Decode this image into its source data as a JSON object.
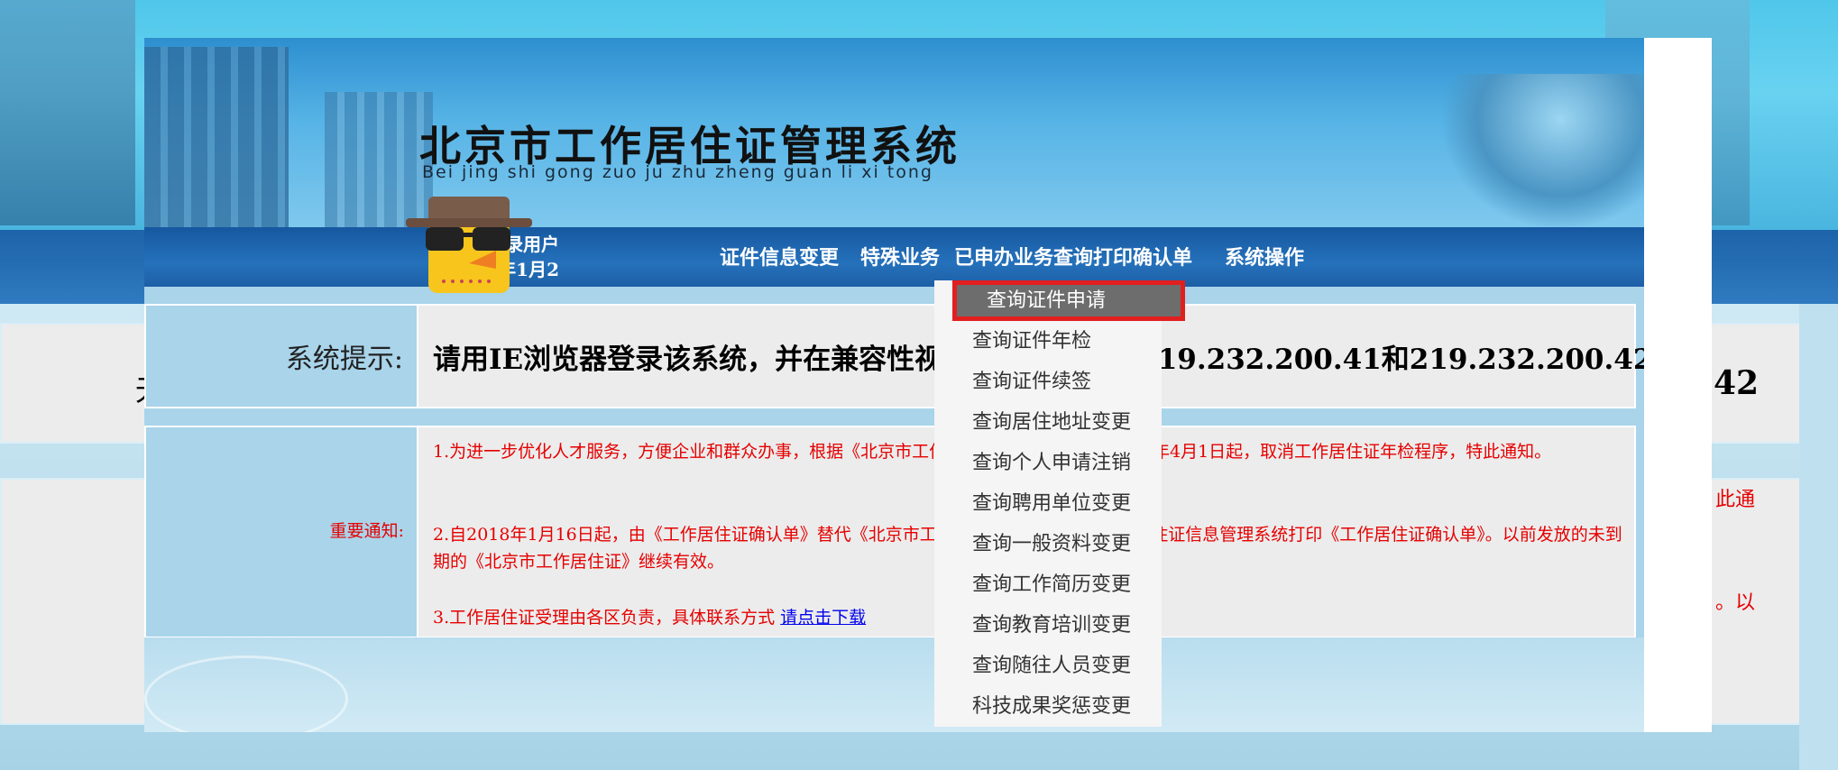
{
  "background": {
    "notice_end_fragment": "42",
    "red_fragment_1": "此通",
    "red_fragment_2": "。以",
    "left_fragment": "无"
  },
  "header": {
    "title": "北京市工作居住证管理系统",
    "pinyin": "Bei jing shi gong zuo ju zhu zheng guan li xi tong"
  },
  "login": {
    "line1": "登录用户",
    "line2": "121年1月2"
  },
  "nav": {
    "items": [
      "证件信息变更",
      "特殊业务",
      "已申办业务查询",
      "打印确认单",
      "系统操作"
    ]
  },
  "dropdown": {
    "items": [
      "查询证件申请",
      "查询证件年检",
      "查询证件续签",
      "查询居住地址变更",
      "查询个人申请注销",
      "查询聘用单位变更",
      "查询一般资料变更",
      "查询工作简历变更",
      "查询教育培训变更",
      "查询随往人员变更",
      "科技成果奖惩变更"
    ],
    "active_index": 0
  },
  "notice": {
    "label": "系统提示:",
    "text": "请用IE浏览器登录该系统，并在兼容性视图设置中添加：219.232.200.41和219.232.200.42"
  },
  "important": {
    "label": "重要通知:",
    "item1": "1.为进一步优化人才服务，方便企业和群众办事，根据《北京市工作居住证管理办法》，自2019年4月1日起，取消工作居住证年检程序，特此通知。",
    "item2": "2.自2018年1月16日起，由《工作居住证确认单》替代《北京市工作居住证》，由北京市工作居住证信息管理系统打印《工作居住证确认单》。以前发放的未到期的《北京市工作居住证》继续有效。",
    "item3_prefix": "3.工作居住证受理由各区负责，具体联系方式 ",
    "item3_link": "请点击下载"
  },
  "colors": {
    "nav_bg": "#1d63a9",
    "alert_red": "#e60000",
    "dropdown_active_bg": "#6d6d6d",
    "highlight_border": "#e11f1f"
  }
}
